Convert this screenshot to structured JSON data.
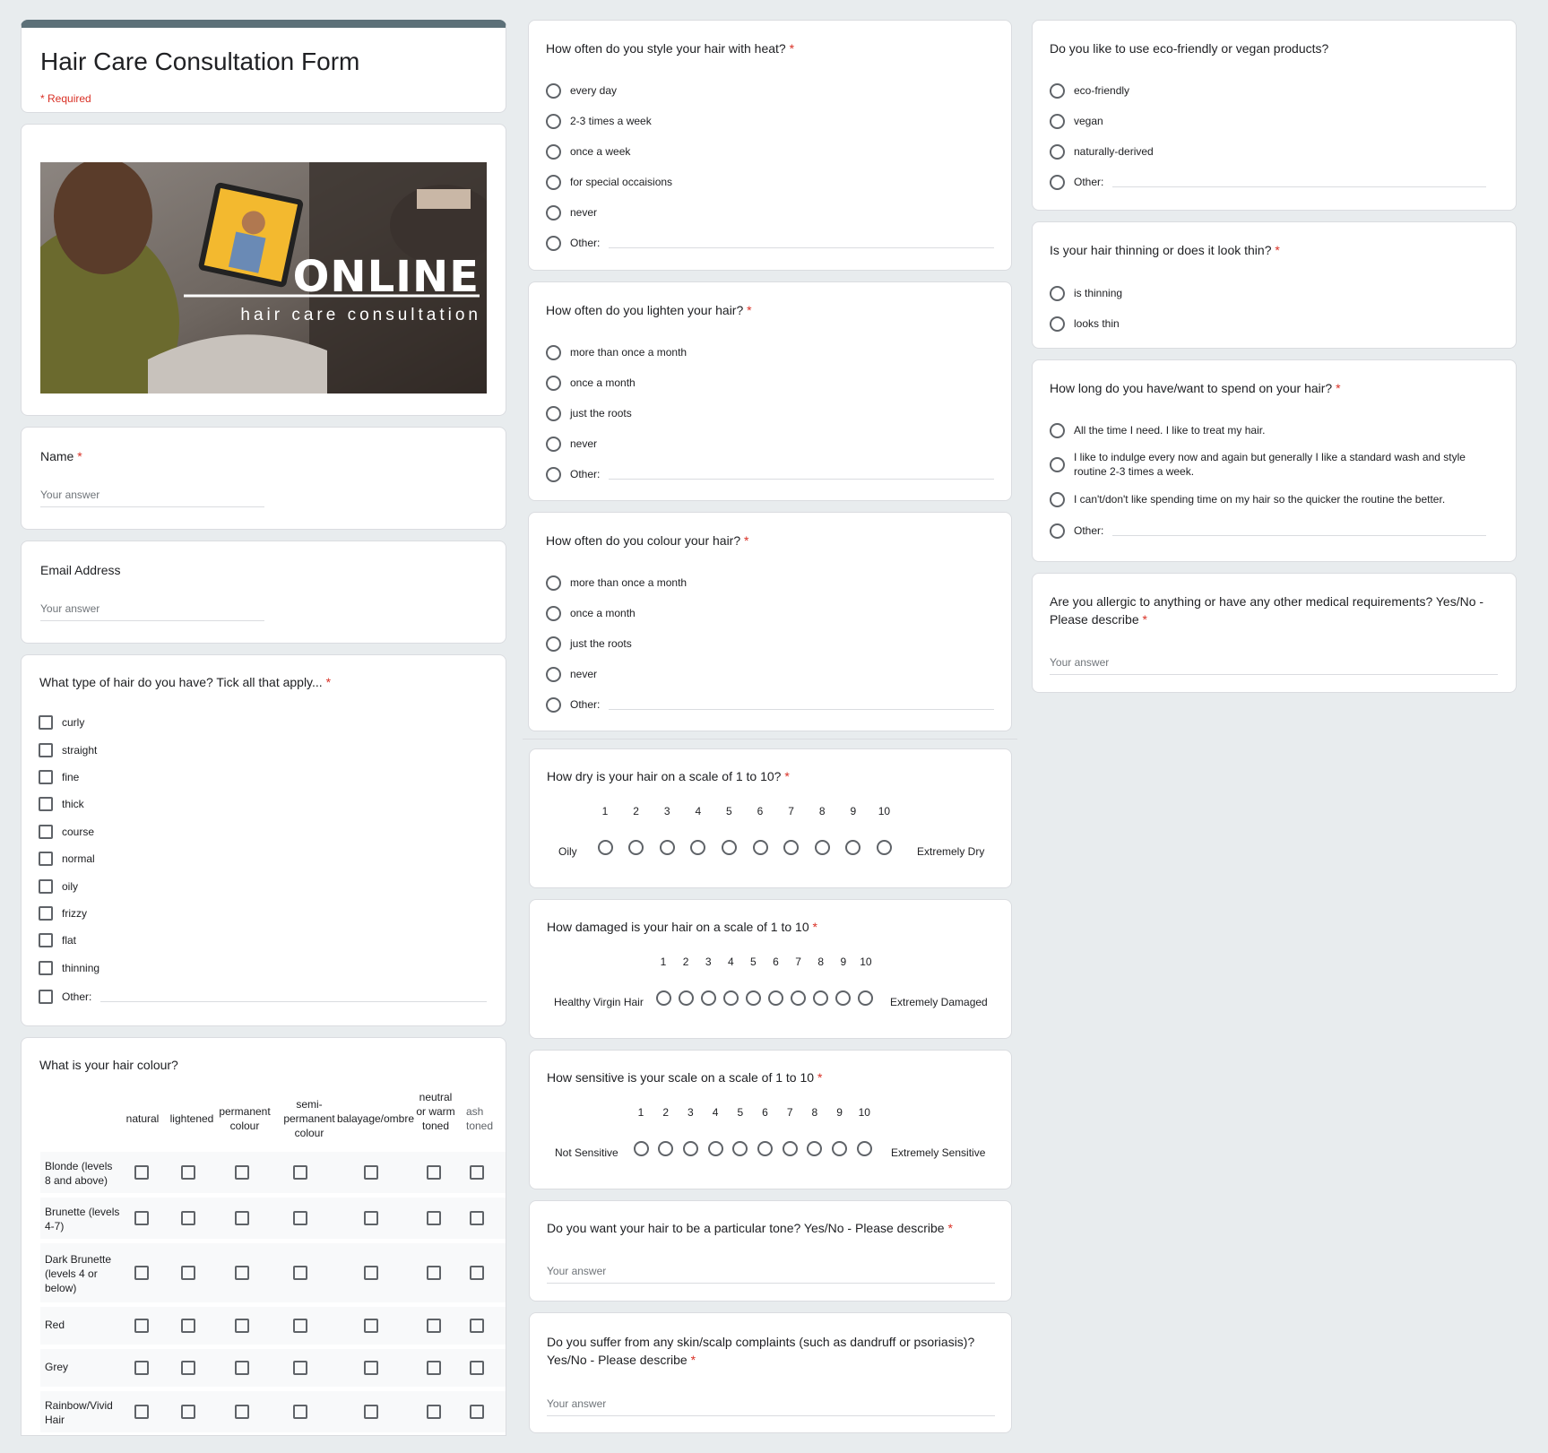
{
  "form": {
    "title": "Hair Care Consultation Form",
    "required_note": "* Required",
    "star": "*",
    "answer_placeholder": "Your answer",
    "other_label": "Other:"
  },
  "banner": {
    "headline": "ONLINE",
    "subline": "hair care consultation"
  },
  "name_q": {
    "label": "Name"
  },
  "email_q": {
    "label": "Email Address"
  },
  "hair_type": {
    "question": "What type of hair do you have? Tick all that apply...",
    "options": [
      "curly",
      "straight",
      "fine",
      "thick",
      "course",
      "normal",
      "oily",
      "frizzy",
      "flat",
      "thinning"
    ]
  },
  "hair_colour": {
    "question": "What is your hair colour?",
    "columns": [
      "natural",
      "lightened",
      "permanent colour",
      "semi-permanent colour",
      "balayage/ombre",
      "neutral or warm toned",
      "ash toned"
    ],
    "rows": [
      "Blonde (levels 8 and above)",
      "Brunette (levels 4-7)",
      "Dark Brunette (levels 4 or below)",
      "Red",
      "Grey",
      "Rainbow/Vivid Hair"
    ]
  },
  "heat": {
    "question": "How often do you style your hair with heat?",
    "options": [
      "every day",
      "2-3 times a week",
      "once a week",
      "for special occaisions",
      "never"
    ]
  },
  "lighten": {
    "question": "How often do you lighten your hair?",
    "options": [
      "more than once a month",
      "once a month",
      "just the roots",
      "never"
    ]
  },
  "colour_freq": {
    "question": "How often do you colour your hair?",
    "options": [
      "more than once a month",
      "once a month",
      "just the roots",
      "never"
    ]
  },
  "dry": {
    "question": "How dry is your hair on a scale of 1 to 10?",
    "low": "Oily",
    "high": "Extremely Dry",
    "numbers": [
      "1",
      "2",
      "3",
      "4",
      "5",
      "6",
      "7",
      "8",
      "9",
      "10"
    ]
  },
  "damage": {
    "question": "How damaged is your hair on a scale of 1 to 10",
    "low": "Healthy Virgin Hair",
    "high": "Extremely Damaged",
    "numbers": [
      "1",
      "2",
      "3",
      "4",
      "5",
      "6",
      "7",
      "8",
      "9",
      "10"
    ]
  },
  "sensitive": {
    "question": "How sensitive is your scale on a scale of 1 to 10",
    "low": "Not Sensitive",
    "high": "Extremely Sensitive",
    "numbers": [
      "1",
      "2",
      "3",
      "4",
      "5",
      "6",
      "7",
      "8",
      "9",
      "10"
    ]
  },
  "tone": {
    "question": "Do you want your hair to be a particular tone? Yes/No - Please describe"
  },
  "skin": {
    "question": "Do you suffer from any skin/scalp complaints (such as dandruff or psoriasis)? Yes/No - Please describe"
  },
  "eco": {
    "question": "Do you like to use eco-friendly or vegan products?",
    "options": [
      "eco-friendly",
      "vegan",
      "naturally-derived"
    ]
  },
  "thin": {
    "question": "Is your hair thinning or does it look thin?",
    "options": [
      "is thinning",
      "looks thin"
    ]
  },
  "time": {
    "question": "How long do you have/want to spend on your hair?",
    "options": [
      "All the time I need. I like to treat my hair.",
      "I like to indulge every now and again but generally I like a standard wash and style routine 2-3 times a week.",
      "I can't/don't like spending time on my hair so the quicker the routine the better."
    ]
  },
  "allergy": {
    "question": "Are you allergic to anything or have any other medical requirements? Yes/No - Please describe"
  },
  "colors": {
    "accent": "#5c7078",
    "required": "#d93025"
  }
}
